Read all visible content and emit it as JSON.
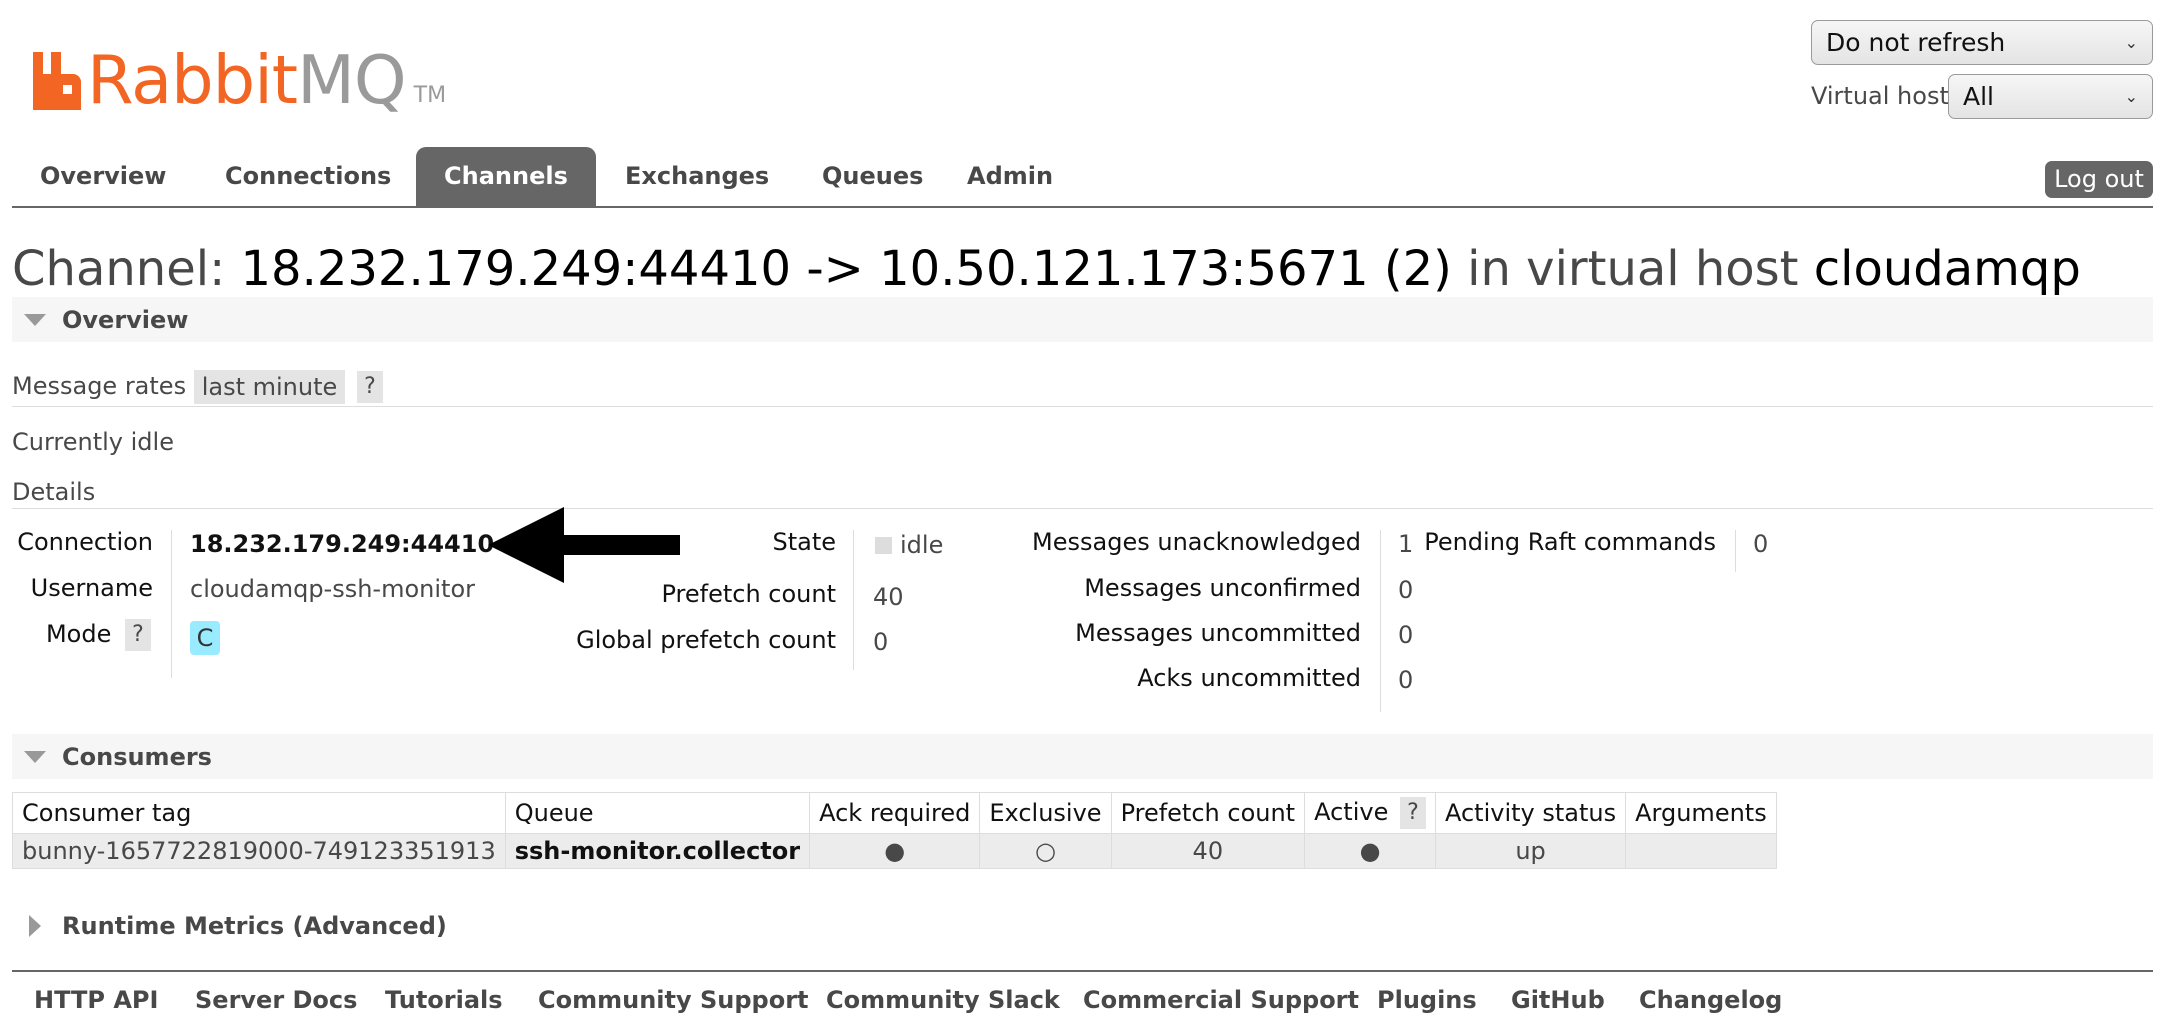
{
  "header": {
    "logo_rabbit": "Rabbit",
    "logo_mq": "MQ",
    "logo_tm": "TM",
    "refresh_select": "Do not refresh",
    "vhost_label": "Virtual host",
    "vhost_select": "All"
  },
  "nav": {
    "tabs": [
      "Overview",
      "Connections",
      "Channels",
      "Exchanges",
      "Queues",
      "Admin"
    ],
    "active": "Channels",
    "logout": "Log out"
  },
  "title": {
    "prefix": "Channel:",
    "channel": "18.232.179.249:44410 -> 10.50.121.173:5671 (2)",
    "middle": "in virtual host",
    "vhost": "cloudamqp"
  },
  "overview": {
    "section": "Overview",
    "rates_label": "Message rates",
    "rates_period": "last minute",
    "help": "?",
    "idle_text": "Currently idle",
    "details_label": "Details"
  },
  "details": {
    "connection_label": "Connection",
    "connection_value": "18.232.179.249:44410",
    "username_label": "Username",
    "username_value": "cloudamqp-ssh-monitor",
    "mode_label": "Mode",
    "mode_help": "?",
    "mode_value": "C",
    "state_label": "State",
    "state_value": "idle",
    "prefetch_label": "Prefetch count",
    "prefetch_value": "40",
    "global_prefetch_label": "Global prefetch count",
    "global_prefetch_value": "0",
    "unacked_label": "Messages unacknowledged",
    "unacked_value": "1",
    "unconfirmed_label": "Messages unconfirmed",
    "unconfirmed_value": "0",
    "uncommitted_label": "Messages uncommitted",
    "uncommitted_value": "0",
    "acks_uncommitted_label": "Acks uncommitted",
    "acks_uncommitted_value": "0",
    "raft_label": "Pending Raft commands",
    "raft_value": "0"
  },
  "consumers": {
    "section": "Consumers",
    "headers": [
      "Consumer tag",
      "Queue",
      "Ack required",
      "Exclusive",
      "Prefetch count",
      "Active",
      "Activity status",
      "Arguments"
    ],
    "active_help": "?",
    "row": {
      "tag": "bunny-1657722819000-749123351913",
      "queue": "ssh-monitor.collector",
      "ack_required": "●",
      "exclusive": "○",
      "prefetch": "40",
      "active": "●",
      "status": "up",
      "arguments": ""
    }
  },
  "runtime": {
    "section": "Runtime Metrics (Advanced)"
  },
  "footer": {
    "links": [
      "HTTP API",
      "Server Docs",
      "Tutorials",
      "Community Support",
      "Community Slack",
      "Commercial Support",
      "Plugins",
      "GitHub",
      "Changelog"
    ]
  },
  "colors": {
    "brand_orange": "#f26522",
    "logo_grey": "#9a9a9a",
    "tab_active_bg": "#666666",
    "mode_badge": "#99ebff"
  }
}
